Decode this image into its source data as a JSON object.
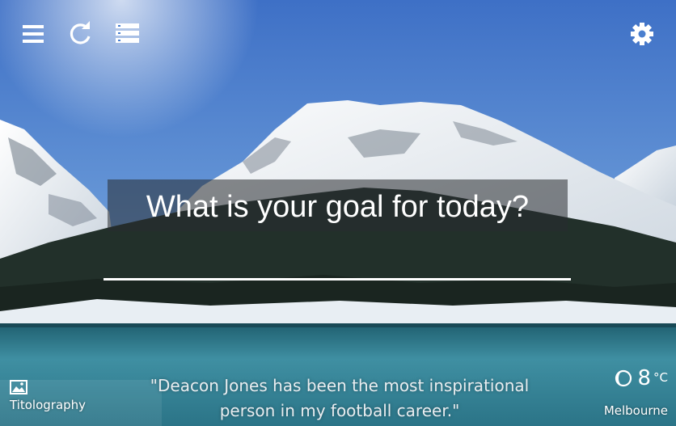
{
  "colors": {
    "sky_top": "#3f72c8",
    "sky_bottom": "#8db7e6",
    "snow": "#f2f5f8",
    "forest": "#1f2b25",
    "lake": "#2f7f93",
    "prompt_box": "#2c3034"
  },
  "toolbar": {
    "menu_icon": "hamburger-menu-icon",
    "refresh_icon": "refresh-icon",
    "list_icon": "list-view-icon",
    "settings_icon": "gear-icon"
  },
  "goal": {
    "prompt": "What is your goal for today?",
    "input_value": "",
    "input_placeholder": ""
  },
  "photo": {
    "icon": "image-icon",
    "credit": "Titolography"
  },
  "quote": {
    "line1": "\"Deacon Jones has been the most inspirational",
    "line2": "person in my football career.\""
  },
  "weather": {
    "icon": "crescent-moon-icon",
    "temperature": "8",
    "unit": "°C",
    "location": "Melbourne"
  }
}
